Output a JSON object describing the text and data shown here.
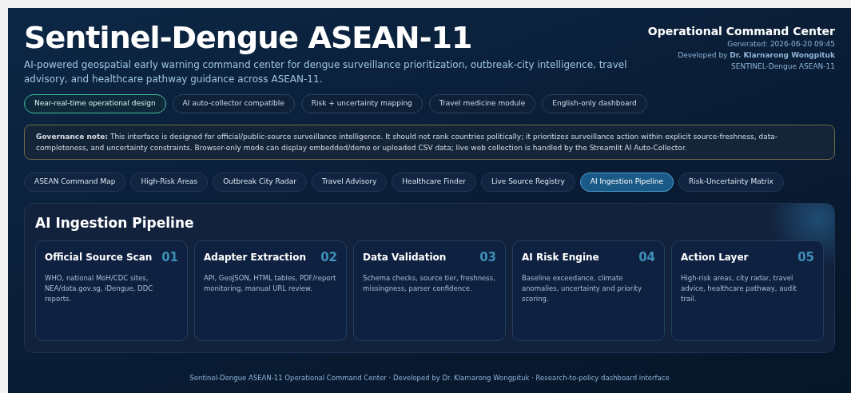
{
  "header": {
    "title": "Sentinel-Dengue ASEAN-11",
    "subtitle": "AI-powered geospatial early warning command center for dengue surveillance prioritization, outbreak-city intelligence, travel advisory, and healthcare pathway guidance across ASEAN-11.",
    "side_title": "Operational Command Center",
    "generated": "Generated: 2026-06-20 09:45",
    "developer": "Developed by **Dr. Klarnarong Wongpituk**",
    "system": "SENTINEL-Dengue ASEAN-11"
  },
  "chips": [
    {
      "label": "Near-real-time operational design",
      "selected": true
    },
    {
      "label": "AI auto-collector compatible",
      "selected": false
    },
    {
      "label": "Risk + uncertainty mapping",
      "selected": false
    },
    {
      "label": "Travel medicine module",
      "selected": false
    },
    {
      "label": "English-only dashboard",
      "selected": false
    }
  ],
  "governance_note": "**Governance note:** This interface is designed for official/public-source surveillance intelligence. It should not rank countries politically; it prioritizes surveillance action within explicit source-freshness, data-completeness, and uncertainty constraints. Browser-only mode can display embedded/demo or uploaded CSV data; live web collection is handled by the Streamlit AI Auto-Collector.",
  "tabs": [
    {
      "label": "ASEAN Command Map",
      "selected": false
    },
    {
      "label": "High-Risk Areas",
      "selected": false
    },
    {
      "label": "Outbreak City Radar",
      "selected": false
    },
    {
      "label": "Travel Advisory",
      "selected": false
    },
    {
      "label": "Healthcare Finder",
      "selected": false
    },
    {
      "label": "Live Source Registry",
      "selected": false
    },
    {
      "label": "AI Ingestion Pipeline",
      "selected": true
    },
    {
      "label": "Risk-Uncertainty Matrix",
      "selected": false
    }
  ],
  "panel": {
    "title": "AI Ingestion Pipeline",
    "steps": [
      {
        "title": "Official Source Scan",
        "number": "01",
        "description": "WHO, national MoH/CDC sites, NEA/data.gov.sg, iDengue, DDC reports."
      },
      {
        "title": "Adapter Extraction",
        "number": "02",
        "description": "API, GeoJSON, HTML tables, PDF/report monitoring, manual URL review."
      },
      {
        "title": "Data Validation",
        "number": "03",
        "description": "Schema checks, source tier, freshness, missingness, parser confidence."
      },
      {
        "title": "AI Risk Engine",
        "number": "04",
        "description": "Baseline exceedance, climate anomalies, uncertainty and priority scoring."
      },
      {
        "title": "Action Layer",
        "number": "05",
        "description": "High-risk areas, city radar, travel advice, healthcare pathway, audit trail."
      }
    ]
  },
  "footer": "Sentinel-Dengue ASEAN-11 Operational Command Center · Developed by Dr. Klarnarong Wongpituk · Research-to-policy dashboard interface"
}
